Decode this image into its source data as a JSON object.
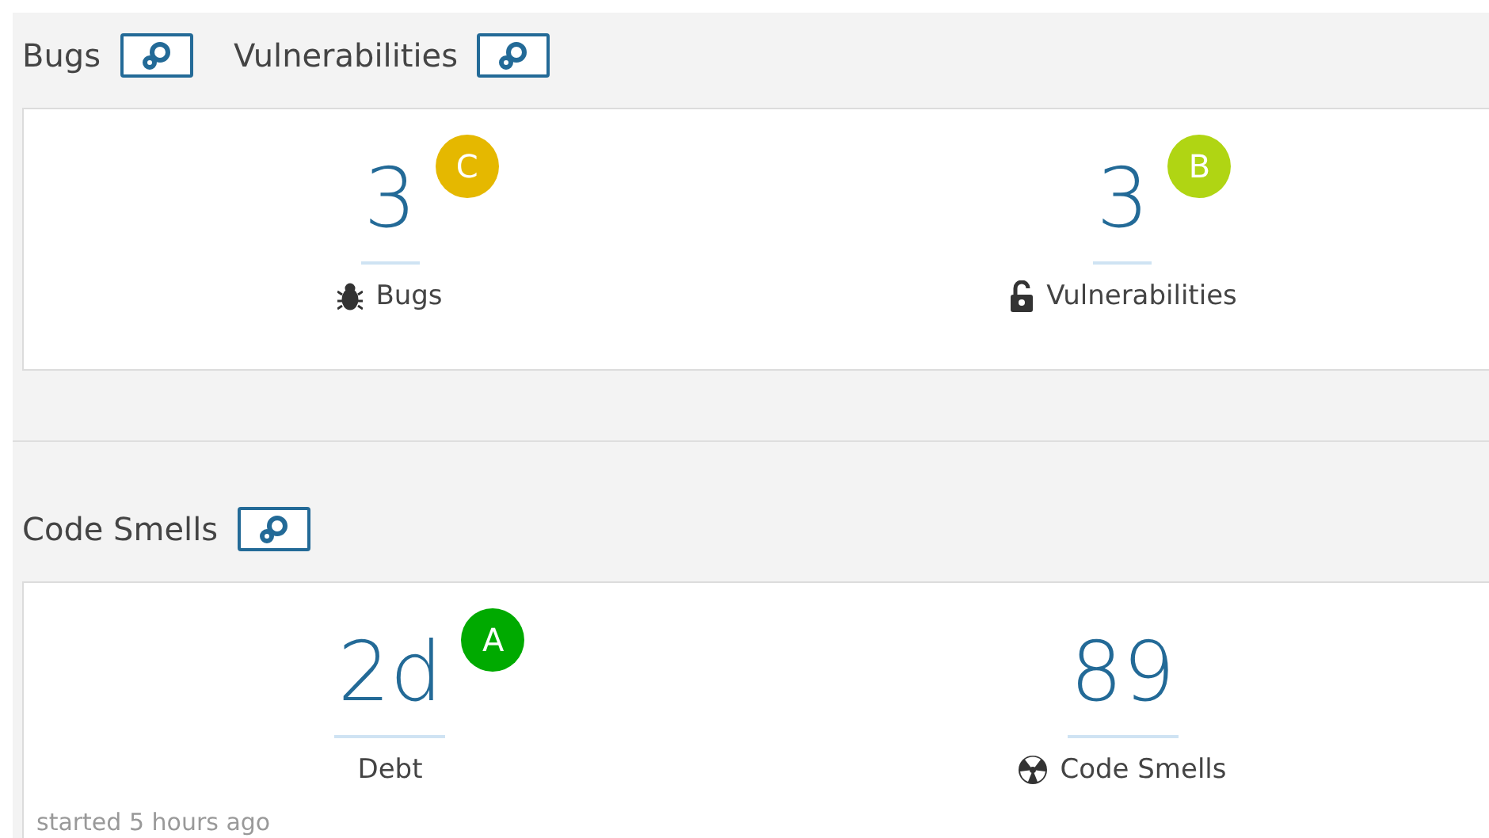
{
  "sections": [
    {
      "headers": [
        {
          "title": "Bugs"
        },
        {
          "title": "Vulnerabilities"
        }
      ],
      "metrics": [
        {
          "value": "3",
          "rating": "C",
          "color": "#e5b800",
          "label": "Bugs",
          "kind": "bug"
        },
        {
          "value": "3",
          "rating": "B",
          "color": "#b0d513",
          "label": "Vulnerabilities",
          "kind": "vulnerability"
        }
      ]
    },
    {
      "headers": [
        {
          "title": "Code Smells"
        }
      ],
      "metrics": [
        {
          "value": "2d",
          "rating": "A",
          "color": "#00aa00",
          "label": "Debt",
          "kind": "debt"
        },
        {
          "value": "89",
          "label": "Code Smells",
          "kind": "code_smell"
        }
      ],
      "footnote": "started 5 hours ago"
    }
  ]
}
